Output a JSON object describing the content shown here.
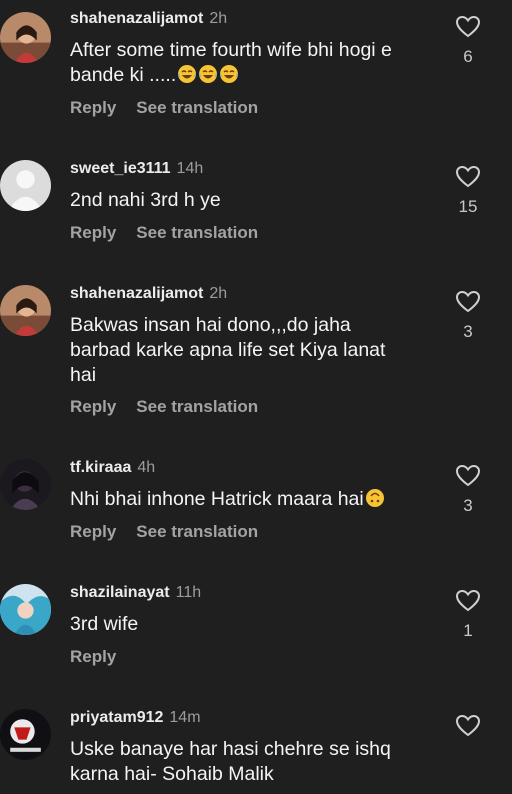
{
  "comments": [
    {
      "user": "shahenazalijamot",
      "time": "2h",
      "text_lines": [
        "After some time fourth wife bhi hogi e",
        "bande ki ....."
      ],
      "emoji_count": 3,
      "emoji_kind": "tears-of-joy",
      "likes": "6",
      "reply": "Reply",
      "translate": "See translation",
      "avatar": "avatar-girl"
    },
    {
      "user": "sweet_ie3111",
      "time": "14h",
      "text_lines": [
        "2nd nahi 3rd h ye"
      ],
      "likes": "15",
      "reply": "Reply",
      "translate": "See translation",
      "avatar": "avatar-default"
    },
    {
      "user": "shahenazalijamot",
      "time": "2h",
      "text_lines": [
        "Bakwas insan hai dono,,,do jaha",
        "barbad karke apna life set Kiya lanat",
        "hai"
      ],
      "likes": "3",
      "reply": "Reply",
      "translate": "See translation",
      "avatar": "avatar-girl"
    },
    {
      "user": "tf.kiraaa",
      "time": "4h",
      "text_lines": [
        "Nhi bhai inhone Hatrick maara hai"
      ],
      "emoji_count": 1,
      "emoji_kind": "upside-down-face",
      "likes": "3",
      "reply": "Reply",
      "translate": "See translation",
      "avatar": "avatar-dark"
    },
    {
      "user": "shazilainayat",
      "time": "11h",
      "text_lines": [
        "3rd wife"
      ],
      "likes": "1",
      "reply": "Reply",
      "avatar": "avatar-blue"
    },
    {
      "user": "priyatam912",
      "time": "14m",
      "text_lines": [
        "Uske banaye har hasi chehre se ishq",
        "karna hai- Sohaib Malik"
      ],
      "likes": "",
      "avatar": "avatar-logo"
    }
  ],
  "colors": {
    "background": "#1f1f1f",
    "text": "#f4f4f4",
    "muted": "#9c9c9c"
  }
}
